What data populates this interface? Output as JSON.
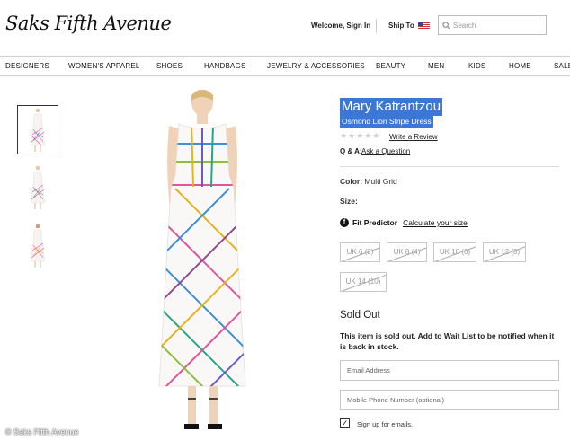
{
  "header": {
    "logo": "Saks Fifth Avenue",
    "welcome": "Welcome, Sign In",
    "ship_to": "Ship To",
    "search_placeholder": "Search"
  },
  "nav": [
    "DESIGNERS",
    "WOMEN'S APPAREL",
    "SHOES",
    "HANDBAGS",
    "JEWELRY & ACCESSORIES",
    "BEAUTY",
    "MEN",
    "KIDS",
    "HOME",
    "SALE"
  ],
  "product": {
    "brand": "Mary Katrantzou",
    "name": "Osmond Lion Stripe Dress",
    "write_review": "Write a Review",
    "qa_label": "Q & A:",
    "ask_question": "Ask a Question",
    "color_label": "Color:",
    "color_value": "Multi Grid",
    "size_label": "Size:",
    "fit_label": "Fit Predictor",
    "fit_link": "Calculate your size",
    "sizes": [
      "UK 6 (2)",
      "UK 8 (4)",
      "UK 10 (6)",
      "UK 12 (8)",
      "UK 14 (10)"
    ]
  },
  "waitlist": {
    "title": "Sold Out",
    "message": "This item is sold out. Add to Wait List to be notified when it is back in stock.",
    "email_placeholder": "Email Address",
    "phone_placeholder": "Mobile Phone Number (optional)",
    "signup_label": "Sign up for emails."
  },
  "credit": "© Saks Fifth Avenue",
  "colors": {
    "highlight": "#3d77d6",
    "border": "#c8c8c8"
  }
}
